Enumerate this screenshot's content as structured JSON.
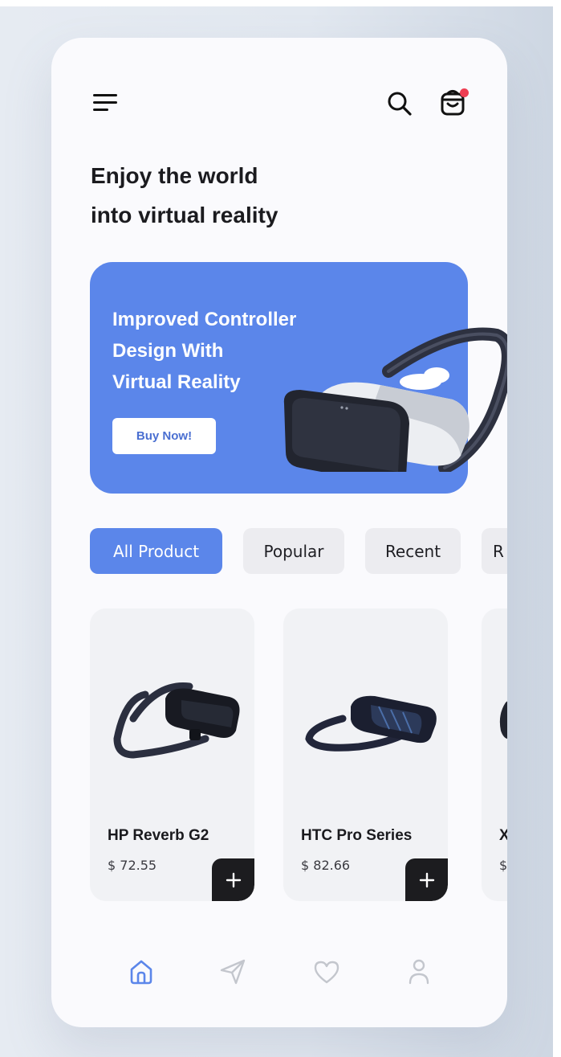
{
  "header": {
    "menu_icon": "hamburger-menu-icon",
    "search_icon": "search-icon",
    "cart_icon": "shopping-bag-icon",
    "cart_badge_color": "#ee3d52"
  },
  "headline": {
    "line1": "Enjoy the world",
    "line2": "into virtual reality"
  },
  "banner": {
    "title_line1": "Improved Controller",
    "title_line2": "Design With",
    "title_line3": "Virtual Reality",
    "button_label": "Buy Now!",
    "background_color": "#5b86ea"
  },
  "categories": [
    {
      "label": "All Product",
      "active": true
    },
    {
      "label": "Popular",
      "active": false
    },
    {
      "label": "Recent",
      "active": false
    },
    {
      "label": "R",
      "active": false
    }
  ],
  "products": [
    {
      "name": "HP Reverb G2",
      "price": "$ 72.55"
    },
    {
      "name": "HTC Pro Series",
      "price": "$ 82.66"
    },
    {
      "name": "X",
      "price": "$"
    }
  ],
  "bottom_nav": [
    {
      "icon": "home-icon",
      "active": true
    },
    {
      "icon": "send-icon",
      "active": false
    },
    {
      "icon": "heart-icon",
      "active": false
    },
    {
      "icon": "user-icon",
      "active": false
    }
  ],
  "colors": {
    "accent": "#5b86ea",
    "nav_active": "#5b86ea",
    "nav_inactive": "#c3c6cd"
  }
}
